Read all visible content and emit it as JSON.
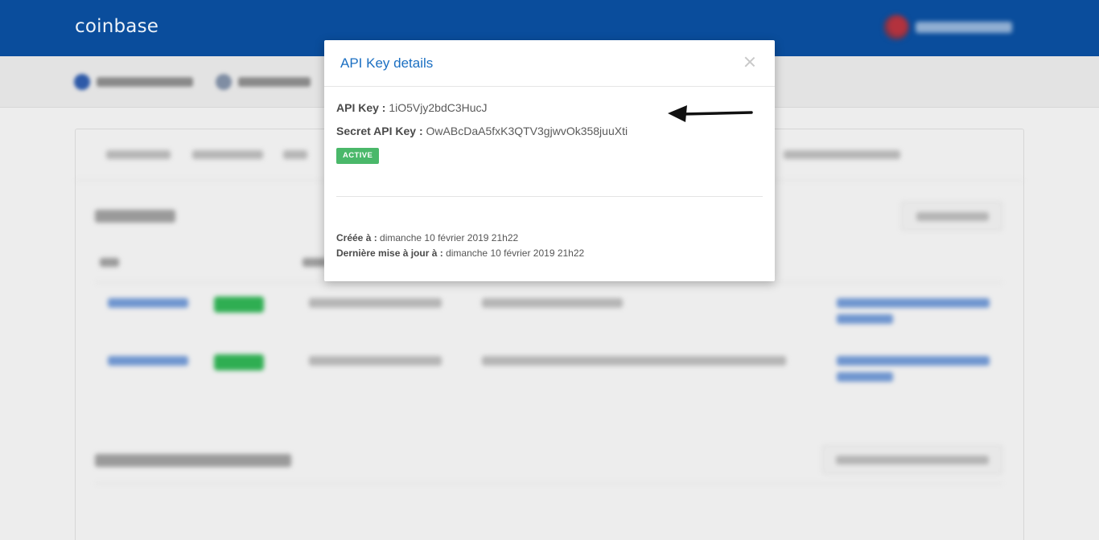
{
  "header": {
    "logo": "coinbase"
  },
  "modal": {
    "title": "API Key details",
    "api_key_label": "API Key :",
    "api_key_value": "1iO5Vjy2bdC3HucJ",
    "secret_key_label": "Secret API Key :",
    "secret_key_value": "OwABcDaA5fxK3QTV3gjwvOk358juuXti",
    "status_badge": "ACTIVE",
    "created_label": "Créée à :",
    "created_value": "dimanche 10 février 2019 21h22",
    "updated_label": "Dernière mise à jour à :",
    "updated_value": "dimanche 10 février 2019 21h22"
  },
  "colors": {
    "header_bg": "#0a4d9c",
    "title_blue": "#1b6fc2",
    "badge_green": "#4ab86a"
  }
}
